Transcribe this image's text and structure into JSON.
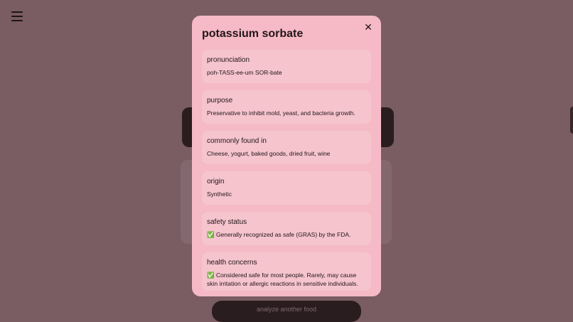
{
  "menu": {
    "icon": "hamburger-menu-icon"
  },
  "background": {
    "bottom_button_label": "analyze another food"
  },
  "modal": {
    "title": "potassium sorbate",
    "close_glyph": "✕",
    "sections": [
      {
        "label": "pronunciation",
        "value": "poh-TASS-ee-um SOR-bate"
      },
      {
        "label": "purpose",
        "value": "Preservative to inhibit mold, yeast, and bacteria growth."
      },
      {
        "label": "commonly found in",
        "value": "Cheese, yogurt, baked goods, dried fruit, wine"
      },
      {
        "label": "origin",
        "value": "Synthetic"
      },
      {
        "label": "safety status",
        "value": "✅ Generally recognized as safe (GRAS) by the FDA."
      },
      {
        "label": "health concerns",
        "value": "✅ Considered safe for most people. Rarely, may cause skin irritation or allergic reactions in sensitive individuals."
      }
    ]
  },
  "colors": {
    "backdrop": "#7a5c63",
    "modal_bg": "#f5bac5",
    "section_bg": "#f5c4cd",
    "text": "#231619"
  }
}
